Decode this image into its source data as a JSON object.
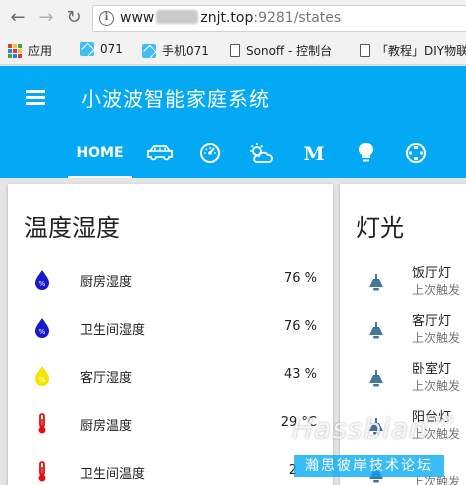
{
  "browser": {
    "url_prefix": "www",
    "url_main": "znjt.top",
    "url_suffix": ":9281/states",
    "bookmarks": [
      {
        "label": "应用",
        "icon": "apps-grid-icon"
      },
      {
        "label": "071",
        "icon": "home-assistant-icon"
      },
      {
        "label": "手机071",
        "icon": "home-assistant-icon"
      },
      {
        "label": "Sonoff - 控制台",
        "icon": "page-icon"
      },
      {
        "label": "「教程」DIY物联",
        "icon": "page-icon"
      }
    ]
  },
  "app": {
    "title": "小波波智能家庭系统",
    "accent_color": "#03a9f4"
  },
  "tabs": [
    {
      "label": "HOME",
      "icon": "home-tab",
      "active": true
    },
    {
      "label": "",
      "icon": "car-icon"
    },
    {
      "label": "",
      "icon": "gauge-icon"
    },
    {
      "label": "",
      "icon": "weather-partly-cloudy-icon"
    },
    {
      "label": "",
      "icon": "mi-logo-icon"
    },
    {
      "label": "",
      "icon": "lightbulb-icon"
    },
    {
      "label": "",
      "icon": "lan-icon"
    }
  ],
  "temp_card": {
    "title": "温度湿度",
    "rows": [
      {
        "name": "厨房湿度",
        "value": "76 %",
        "icon": "water-percent-icon",
        "color": "#1a1acd"
      },
      {
        "name": "卫生间湿度",
        "value": "76 %",
        "icon": "water-percent-icon",
        "color": "#1a1acd"
      },
      {
        "name": "客厅湿度",
        "value": "43 %",
        "icon": "water-percent-icon",
        "color": "#f2e600"
      },
      {
        "name": "厨房温度",
        "value": "29 °C",
        "icon": "thermometer-icon",
        "color": "#e01010"
      },
      {
        "name": "卫生间温度",
        "value": "2",
        "icon": "thermometer-icon",
        "color": "#e01010"
      }
    ]
  },
  "light_card": {
    "title": "灯光",
    "rows": [
      {
        "name": "饭厅灯",
        "sub": "上次触发"
      },
      {
        "name": "客厅灯",
        "sub": "上次触发"
      },
      {
        "name": "卧室灯",
        "sub": "上次触发"
      },
      {
        "name": "阳台灯",
        "sub": "上次触发"
      },
      {
        "name": "",
        "sub": "上次触发"
      }
    ]
  },
  "watermark": {
    "title": "Hassbian",
    "com": ".com",
    "sub": "瀚思彼岸技术论坛"
  }
}
